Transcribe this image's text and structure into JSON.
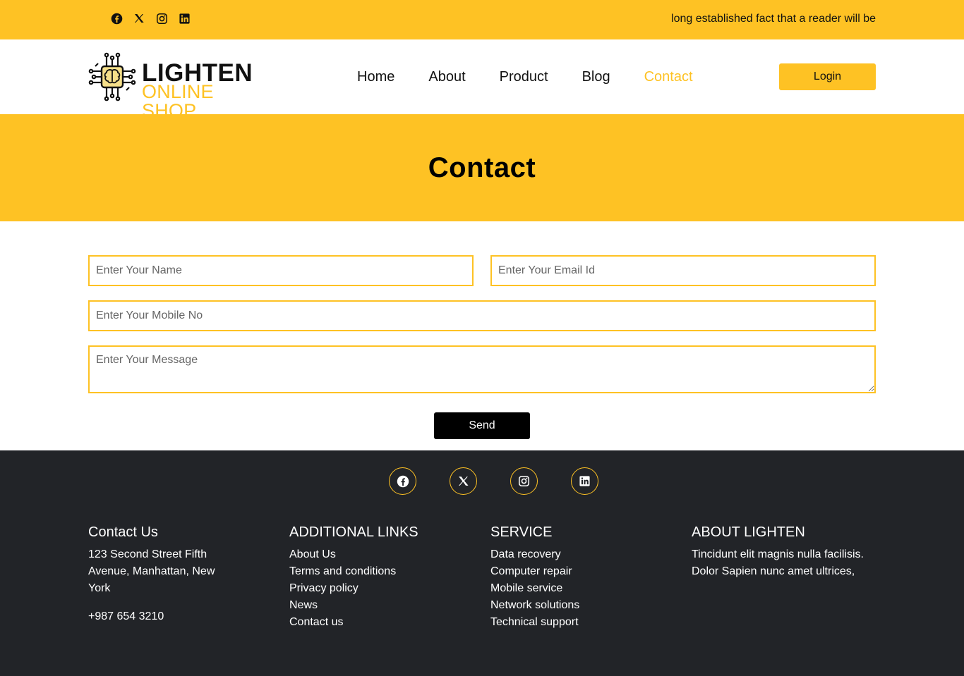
{
  "topbar": {
    "social_icons": [
      "facebook-icon",
      "x-icon",
      "instagram-icon",
      "linkedin-icon"
    ],
    "tagline": "long established fact that a reader will be"
  },
  "header": {
    "brand_line1": "LIGHTEN",
    "brand_line2": "ONLINE SHOP",
    "nav": [
      {
        "label": "Home",
        "active": false
      },
      {
        "label": "About",
        "active": false
      },
      {
        "label": "Product",
        "active": false
      },
      {
        "label": "Blog",
        "active": false
      },
      {
        "label": "Contact",
        "active": true
      }
    ],
    "login_label": "Login"
  },
  "hero": {
    "title": "Contact"
  },
  "form": {
    "name_placeholder": "Enter Your Name",
    "email_placeholder": "Enter Your Email Id",
    "mobile_placeholder": "Enter Your Mobile No",
    "message_placeholder": "Enter Your Message",
    "send_label": "Send"
  },
  "footer": {
    "social_icons": [
      "facebook-icon",
      "x-icon",
      "instagram-icon",
      "linkedin-icon"
    ],
    "contact": {
      "heading": "Contact Us",
      "address": "123 Second Street Fifth Avenue, Manhattan, New York",
      "phone": "+987 654 3210"
    },
    "links": {
      "heading": "ADDITIONAL LINKS",
      "items": [
        "About Us",
        "Terms and conditions",
        "Privacy policy",
        "News",
        "Contact us"
      ]
    },
    "service": {
      "heading": "SERVICE",
      "items": [
        "Data recovery",
        "Computer repair",
        "Mobile service",
        "Network solutions",
        "Technical support"
      ]
    },
    "about": {
      "heading": "ABOUT LIGHTEN",
      "text": "Tincidunt elit magnis nulla facilisis. Dolor Sapien nunc amet ultrices,"
    }
  },
  "colors": {
    "accent": "#fec224",
    "footer_bg": "#222428",
    "text": "#111111"
  }
}
